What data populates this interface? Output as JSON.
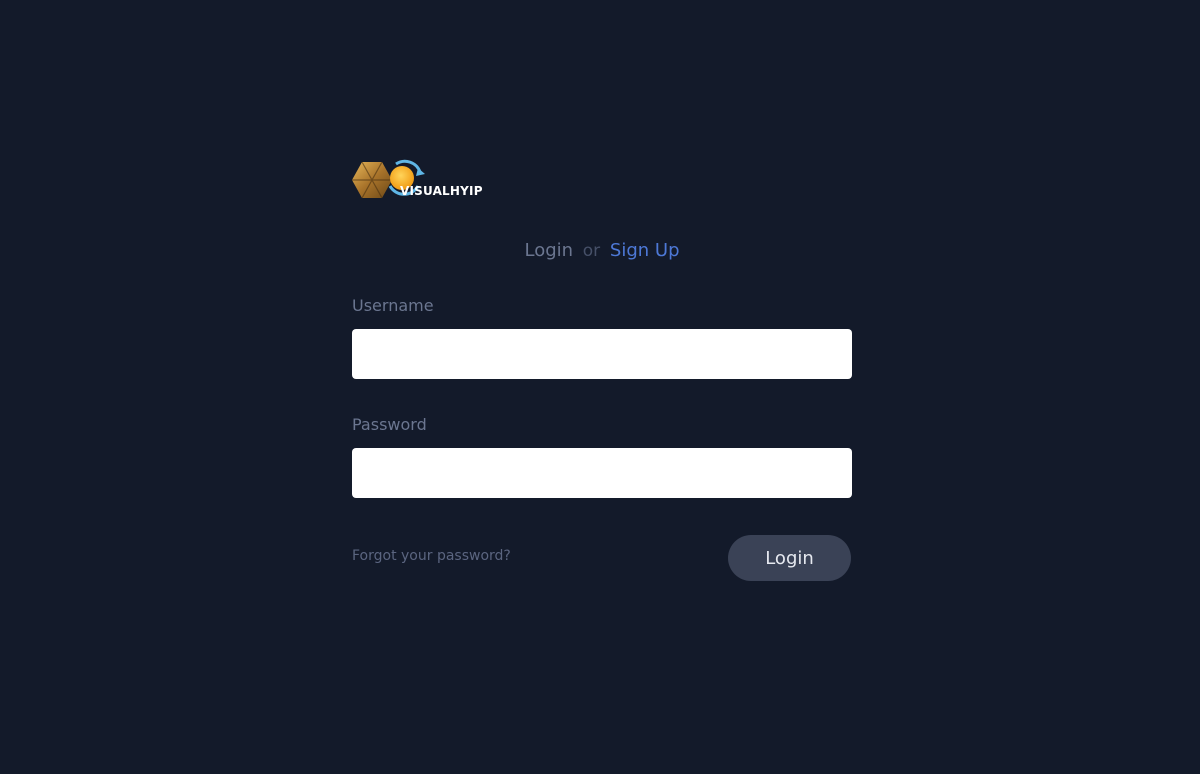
{
  "brand": {
    "name": "VISUALHYIP",
    "logo_icon": "hexagon-coin-logo"
  },
  "auth_switch": {
    "login_label": "Login",
    "or_label": "or",
    "signup_label": "Sign Up"
  },
  "form": {
    "username_label": "Username",
    "username_value": "",
    "password_label": "Password",
    "password_value": "",
    "forgot_label": "Forgot your password?",
    "submit_label": "Login"
  },
  "colors": {
    "background": "#131a2a",
    "accent_link": "#4d78d6",
    "button_bg": "#3a4256",
    "muted_text": "#6b7690"
  }
}
